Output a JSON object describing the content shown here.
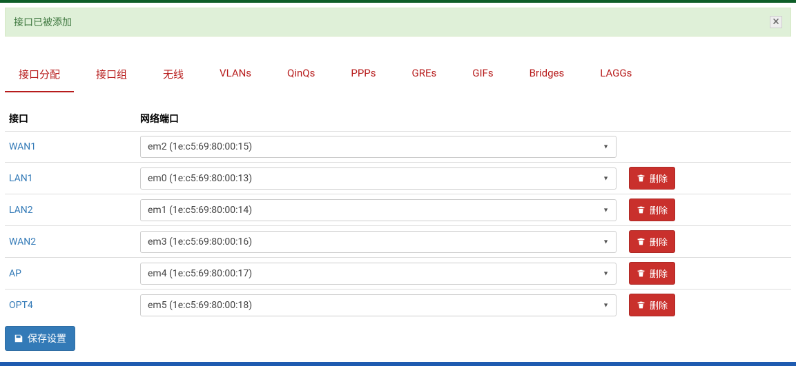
{
  "alert": {
    "message": "接口已被添加"
  },
  "tabs": [
    {
      "label": "接口分配",
      "active": true
    },
    {
      "label": "接口组",
      "active": false
    },
    {
      "label": "无线",
      "active": false
    },
    {
      "label": "VLANs",
      "active": false
    },
    {
      "label": "QinQs",
      "active": false
    },
    {
      "label": "PPPs",
      "active": false
    },
    {
      "label": "GREs",
      "active": false
    },
    {
      "label": "GIFs",
      "active": false
    },
    {
      "label": "Bridges",
      "active": false
    },
    {
      "label": "LAGGs",
      "active": false
    }
  ],
  "table": {
    "headers": {
      "interface": "接口",
      "port": "网络端口"
    },
    "rows": [
      {
        "name": "WAN1",
        "port": "em2 (1e:c5:69:80:00:15)",
        "deletable": false
      },
      {
        "name": "LAN1",
        "port": "em0 (1e:c5:69:80:00:13)",
        "deletable": true
      },
      {
        "name": "LAN2",
        "port": "em1 (1e:c5:69:80:00:14)",
        "deletable": true
      },
      {
        "name": "WAN2",
        "port": "em3 (1e:c5:69:80:00:16)",
        "deletable": true
      },
      {
        "name": "AP",
        "port": "em4 (1e:c5:69:80:00:17)",
        "deletable": true
      },
      {
        "name": "OPT4",
        "port": "em5 (1e:c5:69:80:00:18)",
        "deletable": true
      }
    ]
  },
  "buttons": {
    "save": "保存设置",
    "delete": "删除"
  }
}
